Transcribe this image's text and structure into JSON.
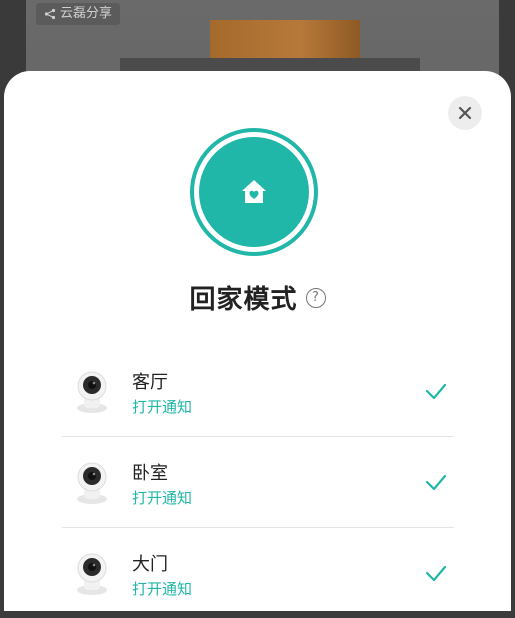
{
  "share": {
    "label": "云磊分享",
    "icon": "share-icon"
  },
  "dialog": {
    "title": "回家模式",
    "mode_icon": "home-heart-icon",
    "help_icon": "question-circle-icon",
    "close_icon": "close-icon",
    "help_symbol": "?"
  },
  "colors": {
    "accent": "#21b7a8",
    "title": "#222222",
    "close_bg": "#ededed"
  },
  "cameras": [
    {
      "name": "客厅",
      "action": "打开通知",
      "selected": true
    },
    {
      "name": "卧室",
      "action": "打开通知",
      "selected": true
    },
    {
      "name": "大门",
      "action": "打开通知",
      "selected": true
    }
  ]
}
